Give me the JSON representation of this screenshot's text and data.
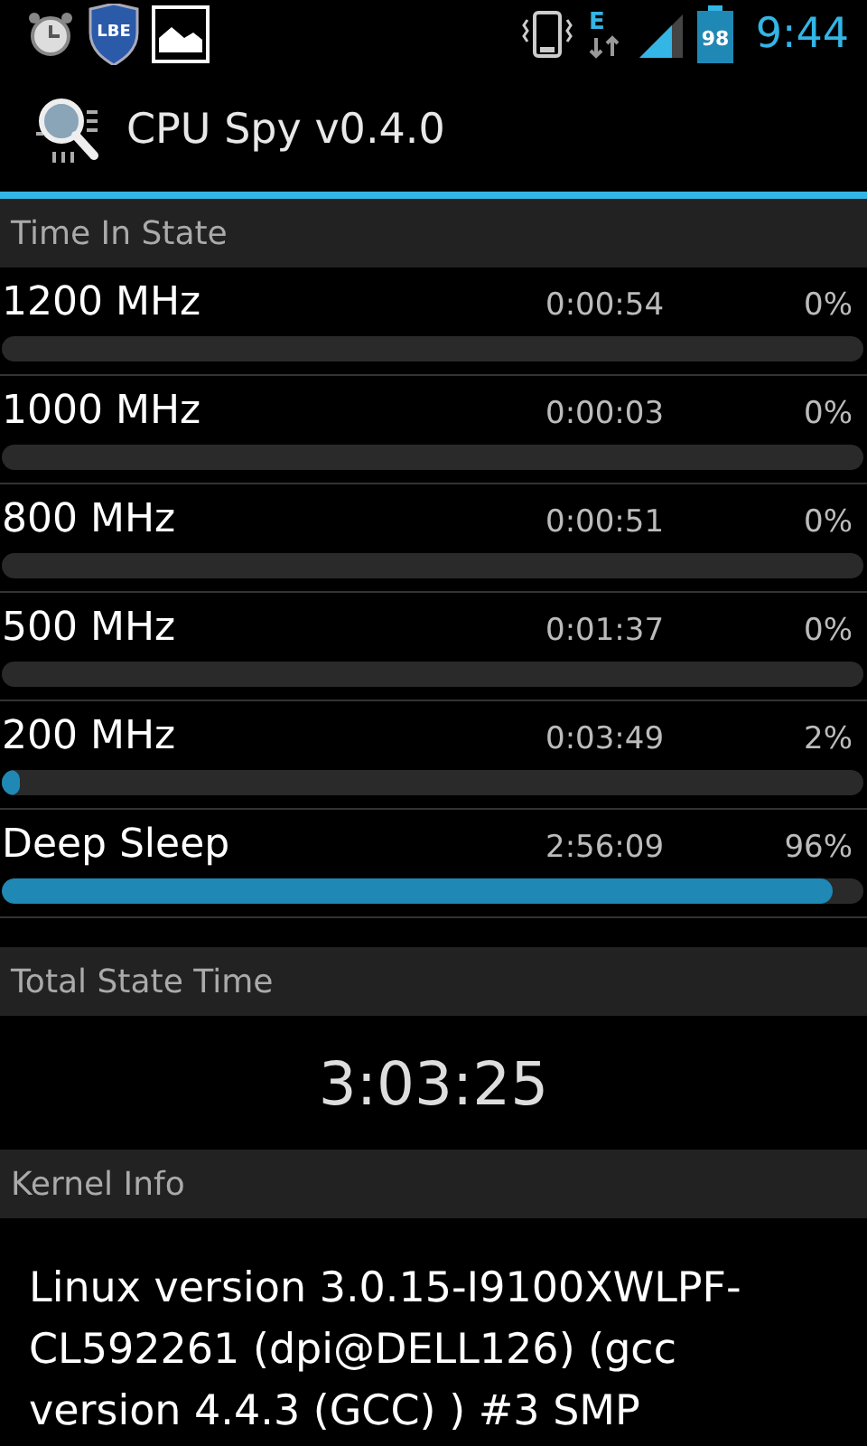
{
  "status_bar": {
    "badge": "LBE",
    "network": "E",
    "battery": "98",
    "time": "9:44"
  },
  "app_bar": {
    "title": "CPU Spy v0.4.0"
  },
  "time_in_state": {
    "header": "Time In State",
    "states": [
      {
        "name": "1200 MHz",
        "time": "0:00:54",
        "percent": "0%"
      },
      {
        "name": "1000 MHz",
        "time": "0:00:03",
        "percent": "0%"
      },
      {
        "name": "800 MHz",
        "time": "0:00:51",
        "percent": "0%"
      },
      {
        "name": "500 MHz",
        "time": "0:01:37",
        "percent": "0%"
      },
      {
        "name": "200 MHz",
        "time": "0:03:49",
        "percent": "2%",
        "level": 0.02
      },
      {
        "name": "Deep Sleep",
        "time": "2:56:09",
        "percent": "96%",
        "level": 0.965
      }
    ]
  },
  "total_state_time": {
    "header": "Total State Time",
    "value": "3:03:25"
  },
  "kernel_info": {
    "header": "Kernel Info",
    "text": "Linux version 3.0.15-I9100XWLPF-CL592261 (dpi@DELL126) (gcc version 4.4.3 (GCC) ) #3 SMP"
  }
}
